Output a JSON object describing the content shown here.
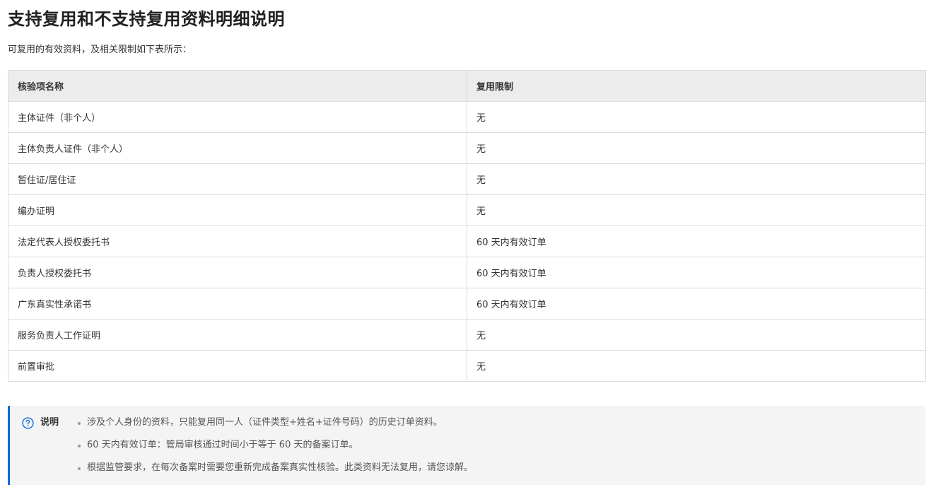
{
  "title": "支持复用和不支持复用资料明细说明",
  "intro": "可复用的有效资料，及相关限制如下表所示：",
  "table": {
    "headers": [
      "核验项名称",
      "复用限制"
    ],
    "rows": [
      [
        "主体证件（非个人）",
        "无"
      ],
      [
        "主体负责人证件（非个人）",
        "无"
      ],
      [
        "暂住证/居住证",
        "无"
      ],
      [
        "编办证明",
        "无"
      ],
      [
        "法定代表人授权委托书",
        "60 天内有效订单"
      ],
      [
        "负责人授权委托书",
        "60 天内有效订单"
      ],
      [
        "广东真实性承诺书",
        "60 天内有效订单"
      ],
      [
        "服务负责人工作证明",
        "无"
      ],
      [
        "前置审批",
        "无"
      ]
    ]
  },
  "note": {
    "icon": "question-circle-icon",
    "label": "说明",
    "accent_color": "#0d6bd8",
    "items": [
      "涉及个人身份的资料，只能复用同一人（证件类型+姓名+证件号码）的历史订单资料。",
      "60 天内有效订单：管局审核通过时间小于等于 60 天的备案订单。",
      "根据监管要求，在每次备案时需要您重新完成备案真实性核验。此类资料无法复用，请您谅解。"
    ]
  }
}
